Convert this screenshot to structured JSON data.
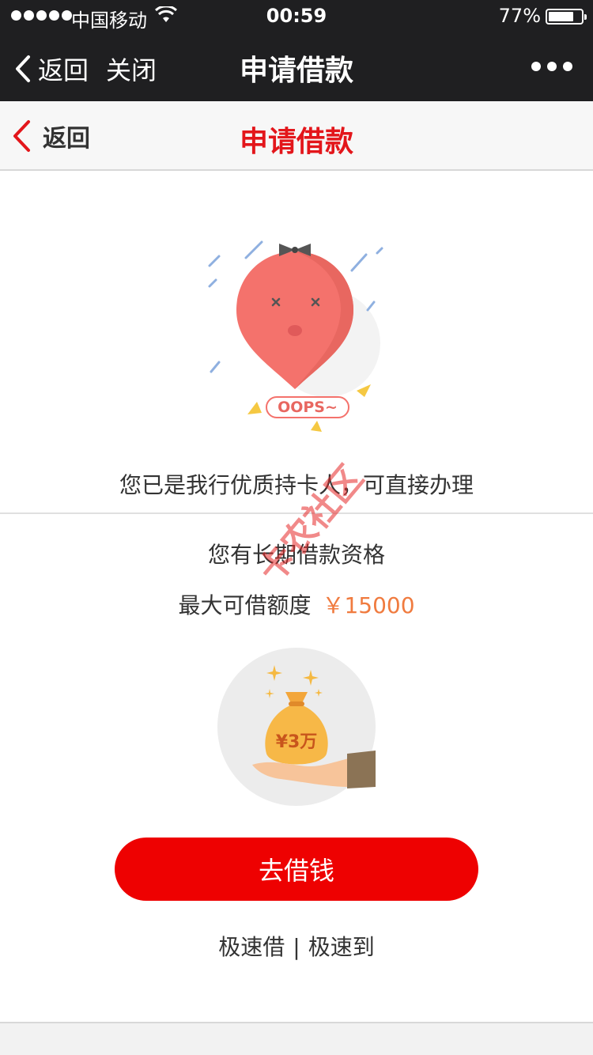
{
  "status_bar": {
    "carrier": "中国移动",
    "time": "00:59",
    "battery": "77%",
    "battery_level": 0.77
  },
  "wx_nav": {
    "back_label": "返回",
    "close_label": "关闭",
    "title": "申请借款"
  },
  "page_header": {
    "back_label": "返回",
    "title": "申请借款"
  },
  "illustration": {
    "badge_text": "OOPS~"
  },
  "content": {
    "message": "您已是我行优质持卡人，可直接办理",
    "eligibility": "您有长期借款资格",
    "limit_label": "最大可借额度",
    "limit_amount": "￥15000",
    "bag_text": "¥3万"
  },
  "cta": {
    "label": "去借钱"
  },
  "tagline": {
    "left": "极速借",
    "separator": "|",
    "right": "极速到"
  },
  "watermark": "卡农社区",
  "colors": {
    "accent_red": "#ee0101",
    "title_red": "#e3161b",
    "amount_orange": "#f07b3f",
    "dark_bar": "#1f1f21"
  }
}
